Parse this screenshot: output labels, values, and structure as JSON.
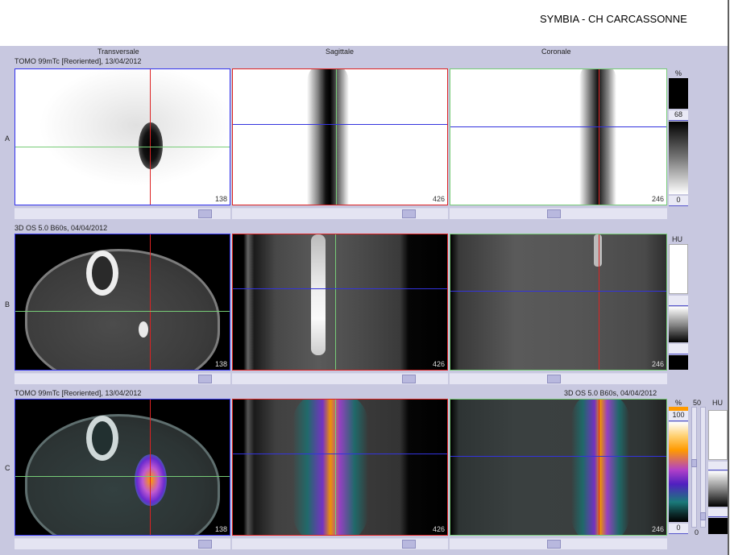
{
  "app": {
    "title": "SYMBIA - CH CARCASSONNE"
  },
  "views": {
    "transversale": "Transversale",
    "sagittale": "Sagittale",
    "coronale": "Coronale"
  },
  "rows": {
    "a": {
      "label": "A",
      "series": "TOMO 99mTc [Reoriented], 13/04/2012"
    },
    "b": {
      "label": "B",
      "series": "3D  OS  5.0  B60s, 04/04/2012"
    },
    "c": {
      "label": "C",
      "series_left": "TOMO 99mTc [Reoriented], 13/04/2012",
      "series_right": "3D  OS  5.0  B60s, 04/04/2012"
    }
  },
  "slices": {
    "trans": "138",
    "sag": "426",
    "cor": "246"
  },
  "colorbars": {
    "a": {
      "unit": "%",
      "max": "68",
      "min": "0"
    },
    "b": {
      "unit": "HU"
    },
    "c": {
      "unit_pct": "%",
      "pct_max": "100",
      "pct_min": "0",
      "hu_val": "50",
      "hu_unit": "HU",
      "hu_min": "0"
    }
  },
  "colors": {
    "crosshair_red": "#dd2222",
    "crosshair_green": "#77cc77",
    "crosshair_blue": "#3333dd",
    "workspace": "#c8c8e0"
  }
}
